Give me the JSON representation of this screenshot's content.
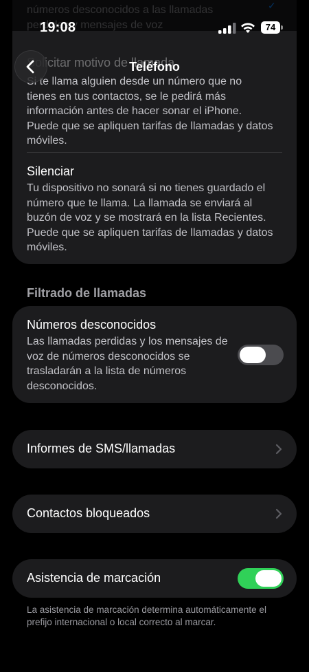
{
  "status_bar": {
    "time": "19:08",
    "battery_level": "74",
    "icons": [
      "cellular-signal-icon",
      "wifi-icon",
      "battery-icon"
    ]
  },
  "nav": {
    "title": "Teléfono",
    "back_icon": "chevron-left-icon"
  },
  "faded_top": {
    "text": "números desconocidos a las llamadas perdidas y mensajes de voz",
    "check_icon": "checkmark-icon"
  },
  "upper_card": {
    "faded_title": "Solicitar motivo de llamada",
    "body": "Si te llama alguien desde un número que no tienes en tus contactos, se le pedirá más información antes de hacer sonar el iPhone. Puede que se apliquen tarifas de llamadas y datos móviles.",
    "silenciar_title": "Silenciar",
    "silenciar_body": "Tu dispositivo no sonará si no tienes guardado el número que te llama. La llamada se enviará al buzón de voz y se mostrará en la lista Recientes. Puede que se apliquen tarifas de llamadas y datos móviles."
  },
  "call_filtering": {
    "header": "Filtrado de llamadas",
    "unknown_numbers": {
      "title": "Números desconocidos",
      "description": "Las llamadas perdidas y los mensajes de voz de números desconocidos se trasladarán a la lista de números desconocidos.",
      "enabled": false
    }
  },
  "rows": {
    "sms_reports": "Informes de SMS/llamadas",
    "blocked_contacts": "Contactos bloqueados",
    "dial_assist": {
      "label": "Asistencia de marcación",
      "enabled": true
    }
  },
  "footnote": "La asistencia de marcación determina automáticamente el prefijo internacional o local correcto al marcar.",
  "colors": {
    "background": "#000000",
    "card": "#1c1c1e",
    "toggle_on": "#30d158",
    "toggle_off": "#4b4b4f",
    "secondary_text": "#c2c2c7"
  }
}
